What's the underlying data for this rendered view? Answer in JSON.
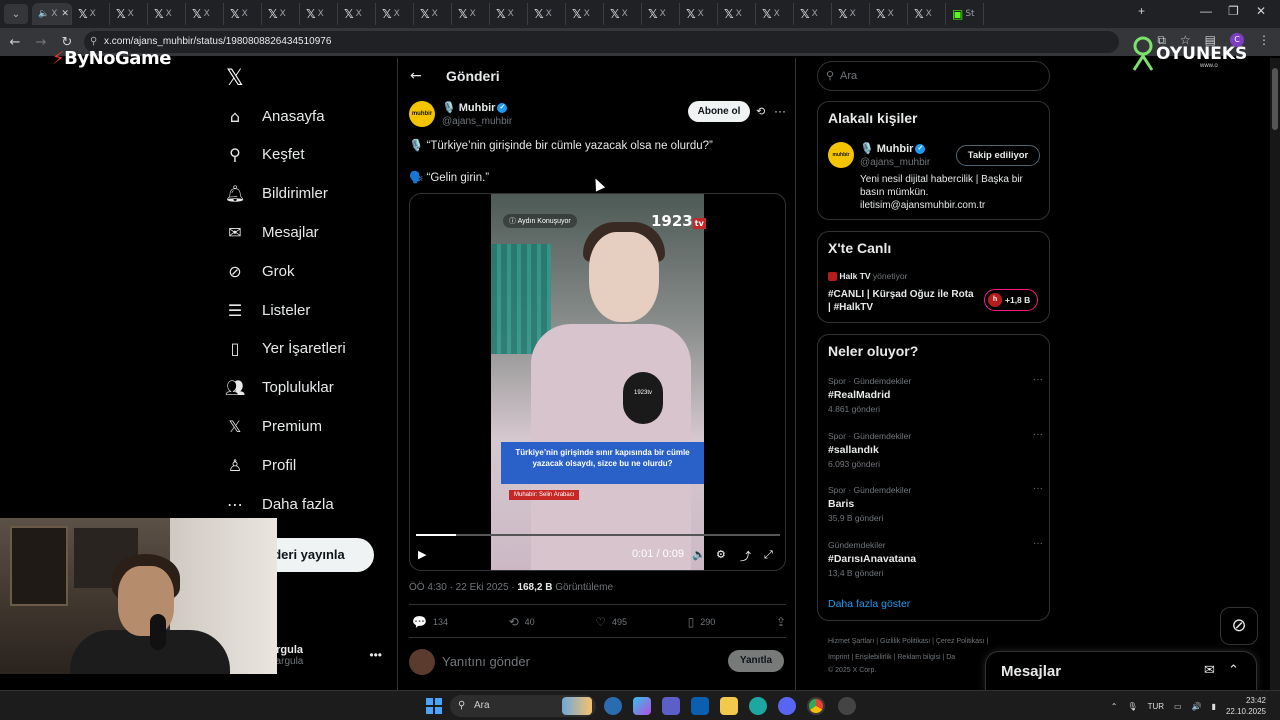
{
  "browser": {
    "tab_count": 25,
    "tab_label": "X",
    "last_tab_label": "St",
    "url": "x.com/ajans_muhbir/status/1980808826434510976"
  },
  "overlays": {
    "bynogame_logo": "ByNoGame",
    "oyuneks_logo": "OYUNEKS",
    "oyuneks_sub": "www.o"
  },
  "sidebar": {
    "items": [
      {
        "label": "Anasayfa",
        "icon": "home-icon"
      },
      {
        "label": "Keşfet",
        "icon": "search-icon"
      },
      {
        "label": "Bildirimler",
        "icon": "bell-icon"
      },
      {
        "label": "Mesajlar",
        "icon": "mail-icon"
      },
      {
        "label": "Grok",
        "icon": "grok-icon"
      },
      {
        "label": "Listeler",
        "icon": "list-icon"
      },
      {
        "label": "Yer İşaretleri",
        "icon": "bookmark-icon"
      },
      {
        "label": "Topluluklar",
        "icon": "communities-icon"
      },
      {
        "label": "Premium",
        "icon": "x-icon"
      },
      {
        "label": "Profil",
        "icon": "profile-icon"
      },
      {
        "label": "Daha fazla",
        "icon": "more-icon"
      }
    ],
    "post_button": "deri yayınla",
    "account_name": "argula",
    "account_handle": "hargula"
  },
  "post": {
    "header_title": "Gönderi",
    "author_name": "Muhbir",
    "author_handle": "@ajans_muhbir",
    "avatar_text": "muhbir",
    "subscribe_label": "Abone ol",
    "line1": "🎙️ “Türkiye’nin girişinde bir cümle yazacak olsa ne olurdu?”",
    "line2": "🗣️ “Gelin girin.”",
    "video": {
      "top_caption": "Aydın Konuşuyor",
      "brand": "1923",
      "brand_tv": "tv",
      "mic_label": "1923tv",
      "caption": "Türkiye’nin girişinde sınır kapısında bir cümle yazacak olsaydı, sizce bu ne olurdu?",
      "reporter": "Muhabir: Selin Arabacı",
      "time": "0:01 / 0:09",
      "progress": 0.11
    },
    "meta_time": "ÖÖ 4:30 · 22 Eki 2025 · ",
    "meta_views": "168,2 B",
    "meta_views_label": " Görüntüleme",
    "stats": {
      "replies": "134",
      "reposts": "40",
      "likes": "495",
      "bookmarks": "290"
    },
    "reply_placeholder": "Yanıtını gönder",
    "reply_button": "Yanıtla"
  },
  "right": {
    "search_placeholder": "Ara",
    "related_title": "Alakalı kişiler",
    "related": {
      "name": "Muhbir",
      "handle": "@ajans_muhbir",
      "follow_label": "Takip ediliyor",
      "bio": "Yeni nesil dijital habercilik | Başka bir basın mümkün. iletisim@ajansmuhbir.com.tr"
    },
    "live_title": "X'te Canlı",
    "live": {
      "host": "Halk TV",
      "host_suffix": " yönetiyor",
      "title": "#CANLI | Kürşad Oğuz ile Rota | #HalkTV",
      "count": "+1,8 B"
    },
    "trends_title": "Neler oluyor?",
    "trends": [
      {
        "cat": "Spor · Gündemdekiler",
        "name": "#RealMadrid",
        "count": "4.861 gönderi"
      },
      {
        "cat": "Spor · Gündemdekiler",
        "name": "#sallandık",
        "count": "6.093 gönderi"
      },
      {
        "cat": "Spor · Gündemdekiler",
        "name": "Baris",
        "count": "35,9 B gönderi"
      },
      {
        "cat": "Gündemdekiler",
        "name": "#DarısıAnavatana",
        "count": "13,4 B gönderi"
      }
    ],
    "show_more": "Daha fazla göster",
    "footer_line1": "Hizmet Şartları  |  Gizlilik Politikası  |  Çerez Politikası  |",
    "footer_line2": "Imprint  |  Erişilebilirlik  |  Reklam bilgisi  |  Da",
    "footer_line3": "© 2025 X Corp."
  },
  "messages_dock": {
    "title": "Mesajlar"
  },
  "taskbar": {
    "search": "Ara",
    "lang": "TUR",
    "time": "23:42",
    "date": "22.10.2025"
  },
  "colors": {
    "accent": "#1d9bf0",
    "muhbir_yellow": "#f5c400",
    "live_pink": "#f91880"
  }
}
